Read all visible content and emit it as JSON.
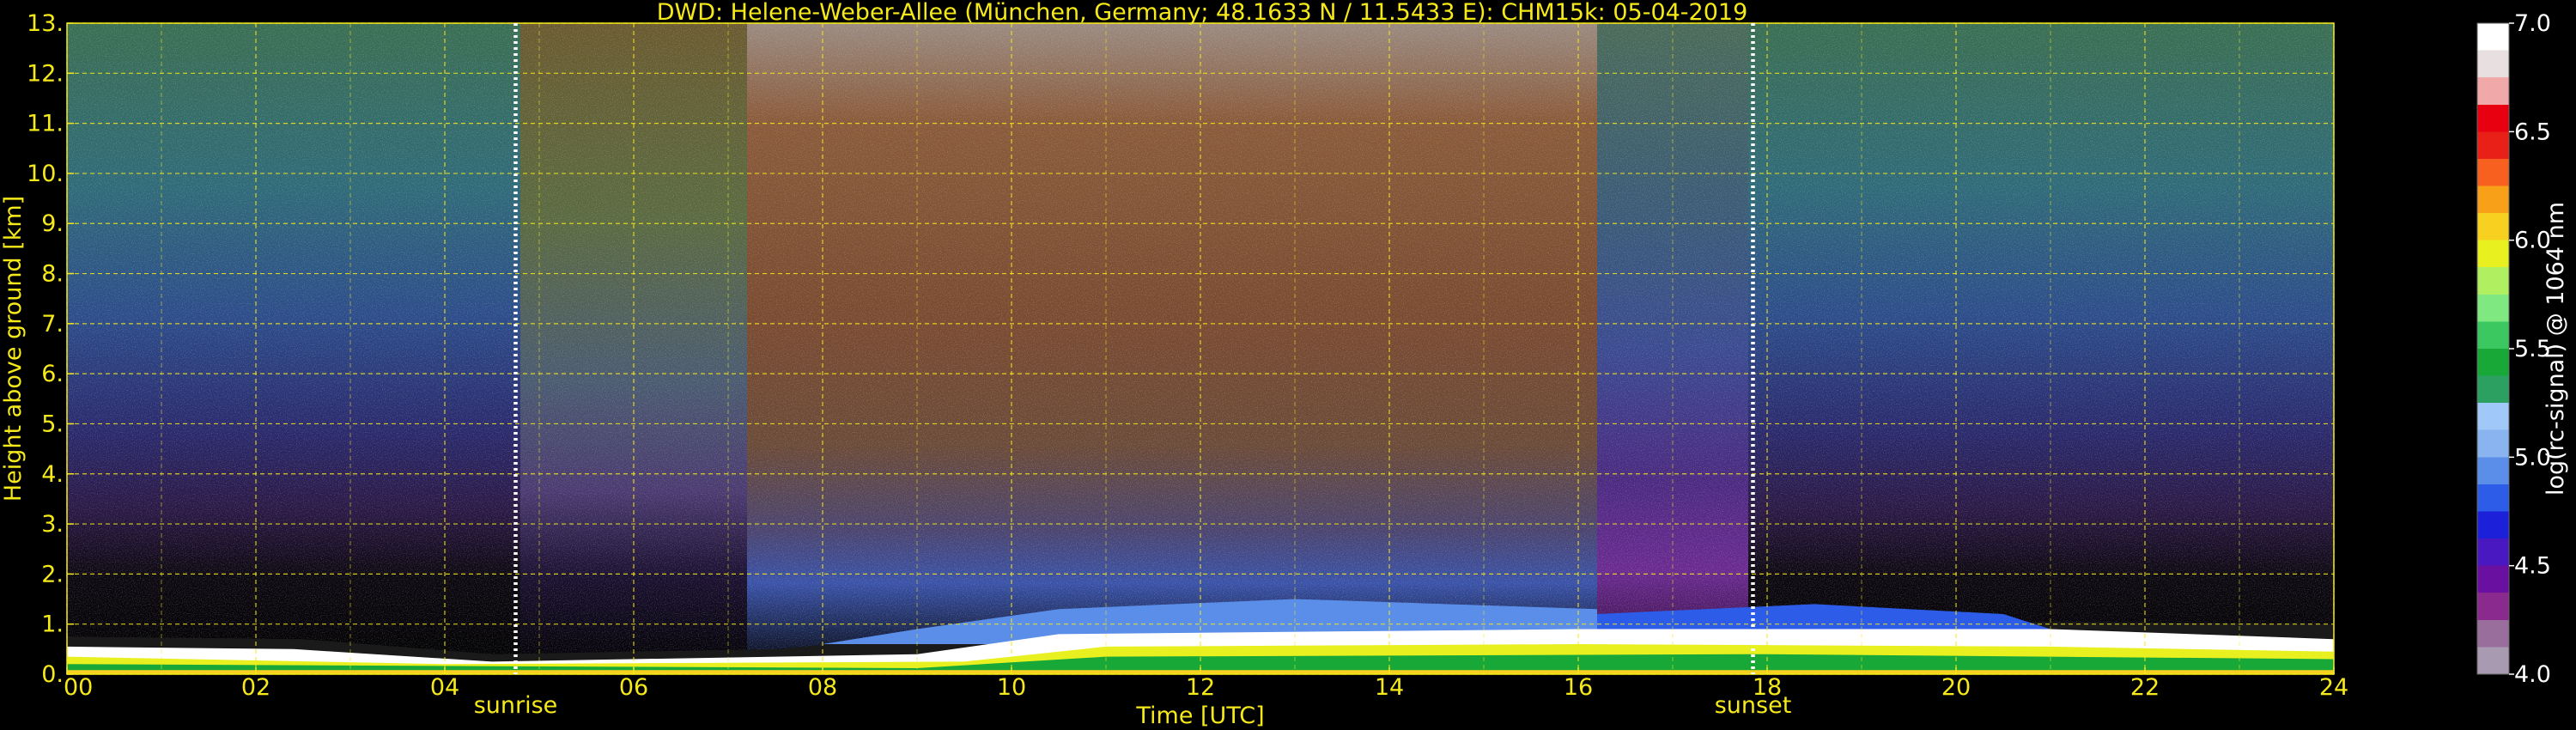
{
  "chart_data": {
    "type": "heatmap",
    "title": "DWD: Helene-Weber-Allee (München, Germany; 48.1633 N / 11.5433 E):    CHM15k: 05-04-2019",
    "xlabel": "Time [UTC]",
    "ylabel": "Height above ground [km]",
    "xlim": [
      0,
      24
    ],
    "ylim": [
      0,
      13
    ],
    "x_ticks": [
      "00",
      "02",
      "04",
      "06",
      "08",
      "10",
      "12",
      "14",
      "16",
      "18",
      "20",
      "22",
      "24"
    ],
    "x_tick_values": [
      0,
      2,
      4,
      6,
      8,
      10,
      12,
      14,
      16,
      18,
      20,
      22,
      24
    ],
    "y_ticks": [
      "0.",
      "1.",
      "2.",
      "3.",
      "4.",
      "5.",
      "6.",
      "7.",
      "8.",
      "9.",
      "10.",
      "11.",
      "12.",
      "13."
    ],
    "y_tick_values": [
      0,
      1,
      2,
      3,
      4,
      5,
      6,
      7,
      8,
      9,
      10,
      11,
      12,
      13
    ],
    "grid": true,
    "annotations": [
      {
        "label": "sunrise",
        "x": 4.75
      },
      {
        "label": "sunset",
        "x": 17.85
      }
    ],
    "colorbar": {
      "label": "log(rc-signal) @ 1064 nm",
      "range": [
        4.0,
        7.0
      ],
      "ticks": [
        "4.0",
        "4.5",
        "5.0",
        "5.5",
        "6.0",
        "6.5",
        "7.0"
      ],
      "tick_values": [
        4.0,
        4.5,
        5.0,
        5.5,
        6.0,
        6.5,
        7.0
      ],
      "colors": [
        "#a89ab0",
        "#9a6e9c",
        "#8a2a8e",
        "#6a10a0",
        "#4a18c0",
        "#1c20d8",
        "#2c5ce8",
        "#5a8ee8",
        "#8ab4f0",
        "#a0c8f8",
        "#2ca060",
        "#18a838",
        "#3cc860",
        "#80e880",
        "#b0f060",
        "#e8f020",
        "#f8d020",
        "#f8a018",
        "#f86020",
        "#e82018",
        "#e80010",
        "#f0a8a8",
        "#e8e0e0",
        "#ffffff"
      ]
    },
    "colors": {
      "text": "#f5e91a",
      "grid": "#f5e91a",
      "background": "#000000"
    }
  }
}
